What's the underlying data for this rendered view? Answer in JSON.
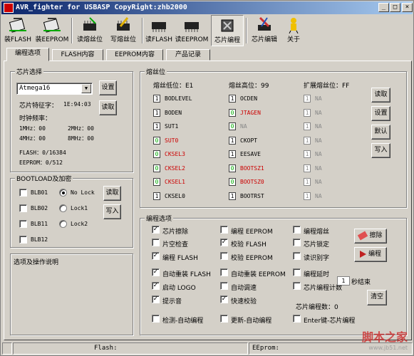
{
  "title": "AVR_fighter for USBASP CopyRight:zhb2000",
  "window_buttons": {
    "minimize": "_",
    "maximize": "□",
    "close": "×"
  },
  "toolbar": {
    "load_flash": "装FLASH",
    "load_eeprom": "装EEPROM",
    "read_fuse": "读熔丝位",
    "write_fuse": "写熔丝位",
    "read_flash": "读FLASH",
    "read_eeprom": "读EEPROM",
    "chip_program": "芯片编程",
    "chip_edit": "芯片编辑",
    "about": "关于"
  },
  "tabs": [
    "编程选项",
    "FLASH内容",
    "EEPROM内容",
    "产品记录"
  ],
  "chip": {
    "group": "芯片选择",
    "selected": "Atmega16",
    "set_btn": "设置",
    "signature_label": "芯片特征字：",
    "signature": "1E:94:03",
    "read_btn": "读取",
    "clock_label": "时钟频率：",
    "clk1": "1MHz：00",
    "clk2": "2MHz：00",
    "clk4": "4MHz：00",
    "clk8": "8MHz：00",
    "flash": "FLASH：0/16384",
    "eeprom": "EEPROM：0/512"
  },
  "bootlock": {
    "group": "BOOTLOAD及加密",
    "blb01": "BLB01",
    "blb02": "BLB02",
    "blb11": "BLB11",
    "blb12": "BLB12",
    "nolock": "No Lock",
    "lock1": "Lock1",
    "lock2": "Lock2",
    "read_btn": "读取",
    "write_btn": "写入"
  },
  "desc": {
    "group": "选项及操作说明"
  },
  "fuse": {
    "group": "熔丝位",
    "low_title": "熔丝低位：E1",
    "high_title": "熔丝高位：99",
    "ext_title": "扩展熔丝位：FF",
    "low": [
      [
        "1",
        "BODLEVEL"
      ],
      [
        "1",
        "BODEN"
      ],
      [
        "1",
        "SUT1"
      ],
      [
        "0",
        "SUT0"
      ],
      [
        "0",
        "CKSEL3"
      ],
      [
        "0",
        "CKSEL2"
      ],
      [
        "0",
        "CKSEL1"
      ],
      [
        "1",
        "CKSEL0"
      ]
    ],
    "high": [
      [
        "1",
        "OCDEN"
      ],
      [
        "0",
        "JTAGEN"
      ],
      [
        "0",
        "NA"
      ],
      [
        "1",
        "CKOPT"
      ],
      [
        "1",
        "EESAVE"
      ],
      [
        "0",
        "BOOTSZ1"
      ],
      [
        "0",
        "BOOTSZ0"
      ],
      [
        "1",
        "BOOTRST"
      ]
    ],
    "ext": [
      [
        "1",
        "NA"
      ],
      [
        "1",
        "NA"
      ],
      [
        "1",
        "NA"
      ],
      [
        "1",
        "NA"
      ],
      [
        "1",
        "NA"
      ],
      [
        "1",
        "NA"
      ],
      [
        "1",
        "NA"
      ],
      [
        "1",
        "NA"
      ]
    ],
    "read_btn": "读取",
    "set_btn": "设置",
    "default_btn": "默认",
    "write_btn": "写入"
  },
  "prog": {
    "group": "编程选项",
    "opts": [
      [
        "芯片擦除",
        true
      ],
      [
        "编程 EEPROM",
        false
      ],
      [
        "编程熔丝",
        false
      ],
      [
        "片空检查",
        false
      ],
      [
        "校验 FLASH",
        true
      ],
      [
        "芯片锁定",
        false
      ],
      [
        "编程 FLASH",
        true
      ],
      [
        "校验 EEPROM",
        false
      ],
      [
        "读识别字",
        false
      ],
      [
        "自动重装 FLASH",
        true
      ],
      [
        "自动重装 EEPROM",
        false
      ],
      [
        "编程延时",
        false
      ],
      [
        "启动 LOGO",
        true
      ],
      [
        "自动调速",
        false
      ],
      [
        "芯片编程计数",
        false
      ],
      [
        "提示音",
        true
      ],
      [
        "快速校验",
        true
      ],
      [
        "检测-自动编程",
        false
      ],
      [
        "更新-自动编程",
        false
      ],
      [
        "Enter键-芯片编程",
        false
      ]
    ],
    "delay_value": "1",
    "delay_suffix": "秒结束",
    "count_label": "芯片编程数：0",
    "erase_btn": "擦除",
    "program_btn": "编程",
    "clear_btn": "清空"
  },
  "status": {
    "flash": "Flash:",
    "eeprom": "EEprom:"
  },
  "watermark": {
    "main": "脚本之家",
    "sub": "www.jb51.net"
  }
}
